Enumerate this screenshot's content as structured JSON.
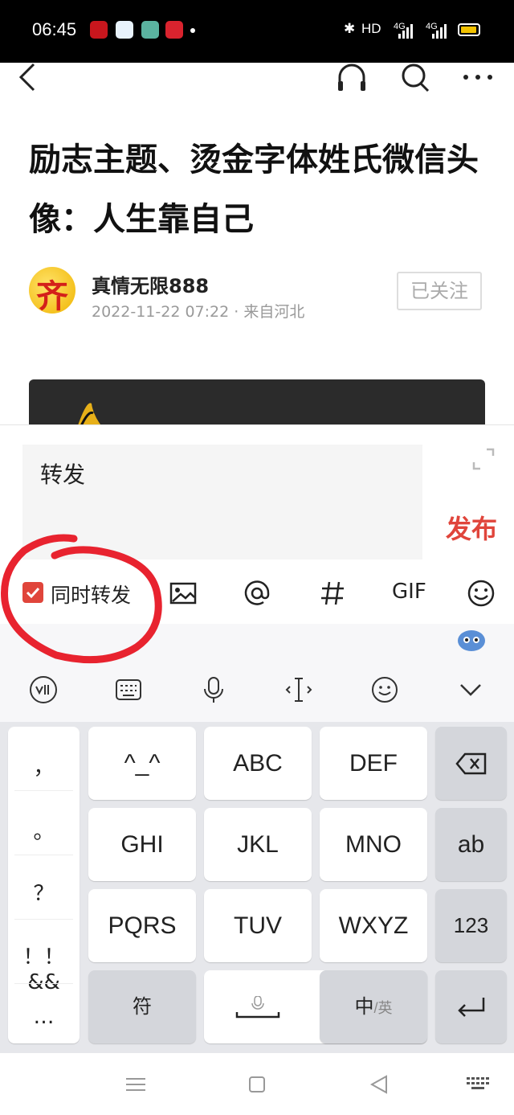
{
  "status_bar": {
    "time": "06:45",
    "network": "HD",
    "sig1": "4G",
    "sig2": "4G"
  },
  "article": {
    "title": "励志主题、烫金字体姓氏微信头像：人生靠自己",
    "author_avatar_char": "齐",
    "author": "真情无限888",
    "meta": "2022-11-22 07:22 · 来自河北",
    "follow_label": "已关注"
  },
  "composer": {
    "input_value": "转发",
    "publish_label": "发布",
    "also_repost_label": "同时转发",
    "also_repost_checked": true,
    "gif_label": "GIF"
  },
  "keyboard": {
    "punct": [
      "，",
      "。",
      "？",
      "！！&&",
      "…"
    ],
    "rows": [
      [
        "^_^",
        "ABC",
        "DEF"
      ],
      [
        "GHI",
        "JKL",
        "MNO"
      ],
      [
        "PQRS",
        "TUV",
        "WXYZ"
      ]
    ],
    "right": [
      "ab",
      "123"
    ],
    "symbol_key": "符",
    "lang_key_main": "中",
    "lang_key_sub": "/英"
  },
  "colors": {
    "accent": "#e0453b",
    "annotation": "#e8232f"
  }
}
